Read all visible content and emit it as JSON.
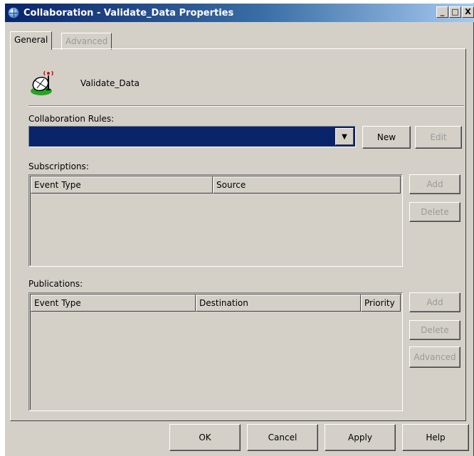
{
  "window": {
    "title": "Collaboration - Validate_Data Properties",
    "minimize": "_",
    "maximize": "□",
    "close": "X"
  },
  "tabs": [
    {
      "label": "General",
      "active": true
    },
    {
      "label": "Advanced",
      "active": false
    }
  ],
  "general": {
    "object_name": "Validate_Data",
    "object_icon": "satellite-dish-icon",
    "collaboration_rules_label": "Collaboration Rules:",
    "collaboration_rules_value": "",
    "new_button": "New",
    "edit_button": "Edit",
    "subscriptions_label": "Subscriptions:",
    "subscriptions_columns": [
      "Event Type",
      "Source"
    ],
    "subscriptions_rows": [],
    "subscriptions_add": "Add",
    "subscriptions_delete": "Delete",
    "publications_label": "Publications:",
    "publications_columns": [
      "Event Type",
      "Destination",
      "Priority"
    ],
    "publications_rows": [],
    "publications_add": "Add",
    "publications_delete": "Delete",
    "publications_advanced": "Advanced"
  },
  "dialog_buttons": {
    "ok": "OK",
    "cancel": "Cancel",
    "apply": "Apply",
    "help": "Help"
  },
  "colors": {
    "face": "#d4d0c8",
    "titlebar_start": "#0a246a",
    "selection": "#0a246a",
    "disabled_text": "#9a9a9a"
  }
}
